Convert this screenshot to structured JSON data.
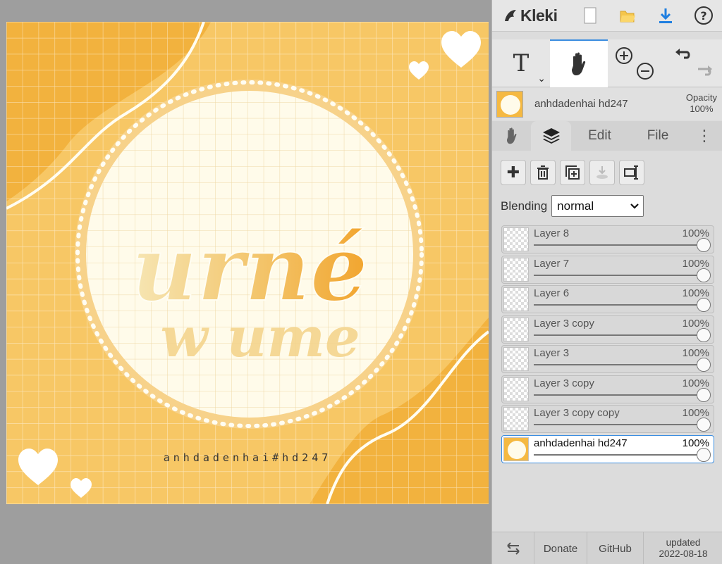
{
  "app": {
    "name": "Kleki"
  },
  "artwork": {
    "caption": "anhdadenhai#hd247",
    "colors": {
      "background": "#f7c765",
      "accent": "#f2b23e",
      "circle": "#fffbea",
      "grid": "#ffffff"
    }
  },
  "toolbar": {
    "text_tool_label": "T",
    "active_tool": "hand"
  },
  "active_layer": {
    "name": "anhdadenhai hd247",
    "opacity_label": "Opacity",
    "opacity_value": "100%"
  },
  "tabs": {
    "edit": "Edit",
    "file": "File",
    "more": "⋮",
    "active": "layers"
  },
  "blending": {
    "label": "Blending",
    "value": "normal"
  },
  "layers": [
    {
      "name": "Layer 8",
      "opacity": "100%",
      "thumb": "transparent",
      "selected": false
    },
    {
      "name": "Layer 7",
      "opacity": "100%",
      "thumb": "transparent",
      "selected": false
    },
    {
      "name": "Layer 6",
      "opacity": "100%",
      "thumb": "transparent",
      "selected": false
    },
    {
      "name": "Layer 3 copy",
      "opacity": "100%",
      "thumb": "transparent",
      "selected": false
    },
    {
      "name": "Layer 3",
      "opacity": "100%",
      "thumb": "transparent",
      "selected": false
    },
    {
      "name": "Layer 3 copy",
      "opacity": "100%",
      "thumb": "transparent",
      "selected": false
    },
    {
      "name": "Layer 3 copy copy",
      "opacity": "100%",
      "thumb": "transparent",
      "selected": false
    },
    {
      "name": "anhdadenhai hd247",
      "opacity": "100%",
      "thumb": "art",
      "selected": true
    }
  ],
  "bottom_bar": {
    "donate": "Donate",
    "github": "GitHub",
    "updated_label": "updated",
    "updated_date": "2022-08-18"
  },
  "colors": {
    "accent_blue": "#3b8de0",
    "panel_bg": "#dcdcdc",
    "canvas_bg": "#9e9e9e"
  }
}
